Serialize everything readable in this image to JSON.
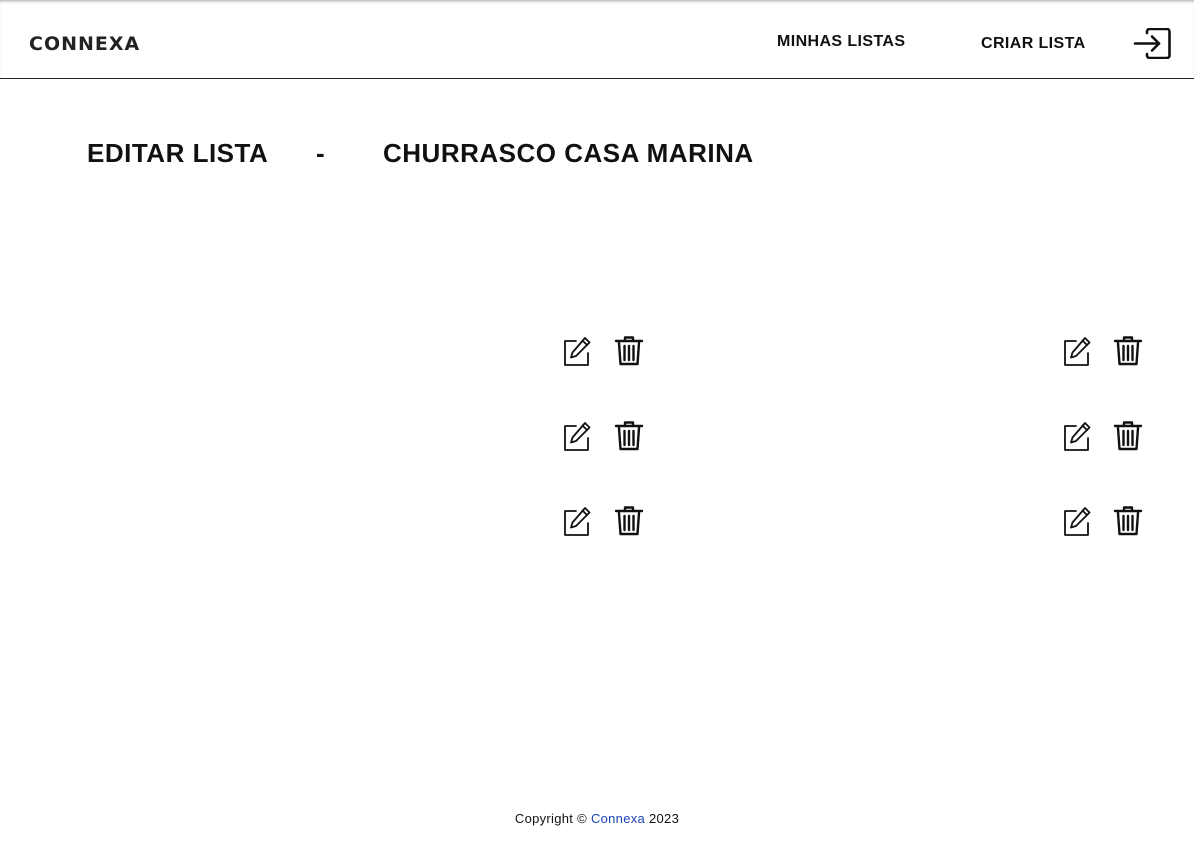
{
  "header": {
    "logo": "CONNEXA",
    "nav": {
      "minhas_listas": "MINHAS LISTAS",
      "criar_lista": "CRIAR LISTA"
    },
    "logout_icon": "login-arrow-box-icon"
  },
  "main": {
    "title_prefix": "EDITAR LISTA",
    "title_separator": "-",
    "list_name": "CHURRASCO CASA MARINA",
    "row_icons": [
      "edit-icon",
      "trash-icon"
    ]
  },
  "footer": {
    "copyright_prefix": "Copyright ©",
    "brand": "Connexa",
    "year": "2023"
  }
}
